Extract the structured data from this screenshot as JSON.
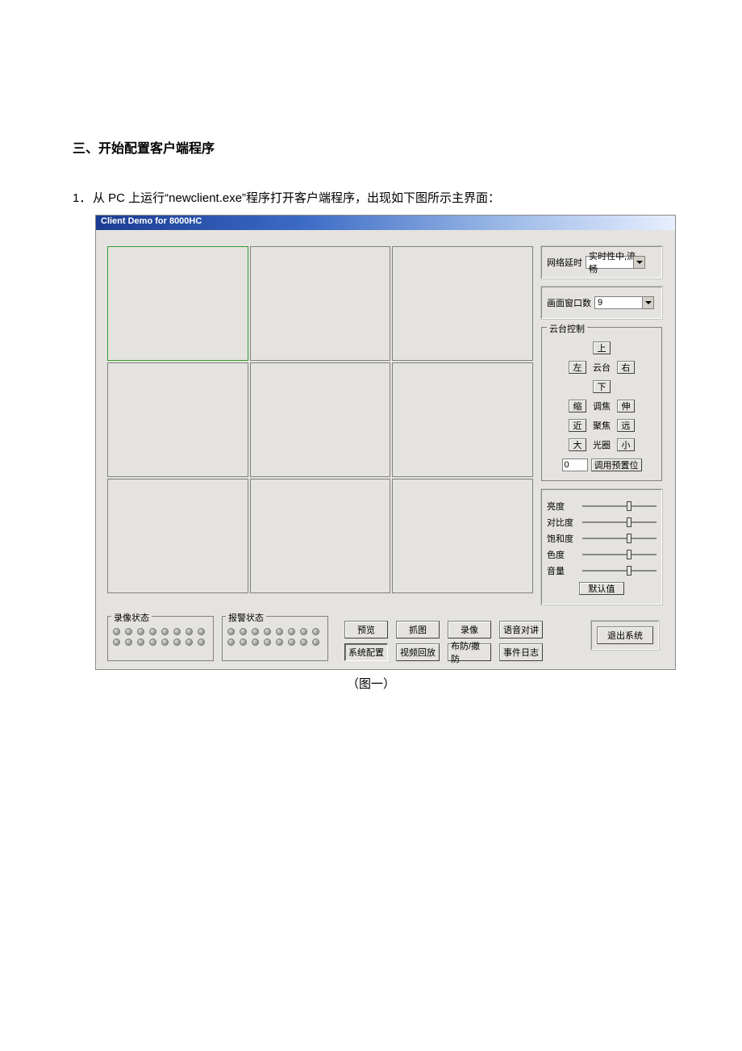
{
  "doc": {
    "heading": "三、开始配置客户端程序",
    "step_num": "1．",
    "step_text": "从 PC 上运行“newclient.exe”程序打开客户端程序，出现如下图所示主界面：",
    "caption": "（图一）"
  },
  "app": {
    "title": "Client Demo for 8000HC",
    "net_delay_label": "网络延时",
    "net_delay_value": "实时性中,流畅",
    "window_count_label": "画面窗口数",
    "window_count_value": "9",
    "ptz_title": "云台控制",
    "ptz": {
      "up": "上",
      "down": "下",
      "left": "左",
      "right": "右",
      "center": "云台",
      "zoom_in": "缩",
      "zoom_label": "调焦",
      "zoom_out": "伸",
      "focus_near": "近",
      "focus_label": "聚焦",
      "focus_far": "远",
      "iris_open": "大",
      "iris_label": "光圈",
      "iris_close": "小",
      "preset_value": "0",
      "preset_btn": "调用预置位"
    },
    "sliders": {
      "brightness": "亮度",
      "contrast": "对比度",
      "saturation": "饱和度",
      "hue": "色度",
      "volume": "音量",
      "default_btn": "默认值"
    },
    "status": {
      "record_title": "录像状态",
      "alarm_title": "报警状态"
    },
    "cmd": {
      "preview": "预览",
      "snapshot": "抓图",
      "record": "录像",
      "voice": "语音对讲",
      "config": "系统配置",
      "playback": "视频回放",
      "guard": "布防/撤防",
      "log": "事件日志"
    },
    "exit": "退出系统"
  }
}
